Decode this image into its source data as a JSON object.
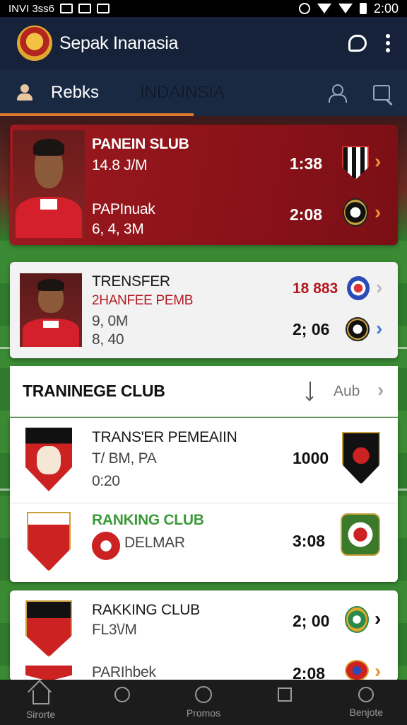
{
  "status_bar": {
    "left_text": "INVI 3ss6",
    "time": "2:00"
  },
  "app_bar": {
    "title": "Sepak Inanasia"
  },
  "tabs": {
    "tab1": "Rebks",
    "tab2": "INDAINSIA"
  },
  "featured_card": {
    "title": "PANEIN SLUB",
    "subtitle": "14.8 J/M",
    "line3": "PAPInuak",
    "line4": "6, 4, 3M",
    "score1": "1:38",
    "score2": "2:08"
  },
  "transfer_card": {
    "title": "TRENSFER",
    "subtitle": "2HANFEE PEMB",
    "line3": "9, 0M",
    "line4": "8, 40",
    "score1": "18 883",
    "score2": "2; 06"
  },
  "section": {
    "title": "TRANINEGE CLUB",
    "action": "Aub"
  },
  "list": [
    {
      "title": "TRANS'ER PEMEAIIN",
      "line2": "T/ BM, PA",
      "line3": "0:20",
      "score": "1000"
    },
    {
      "title": "RANKING CLUB",
      "line2": "DELMAR",
      "score": "3:08"
    }
  ],
  "bottom_card": {
    "title": "RAKKING CLUB",
    "line2": "FL3\\/M",
    "line3": "PARIhbek",
    "score1": "2; 00",
    "score2": "2:08"
  },
  "bottom_nav": [
    "Sirorte",
    "Promos",
    "",
    "",
    "Benjote"
  ],
  "colors": {
    "accent": "#e07a2e",
    "card_red": "#9c1a1f",
    "appbar": "#15223a"
  }
}
